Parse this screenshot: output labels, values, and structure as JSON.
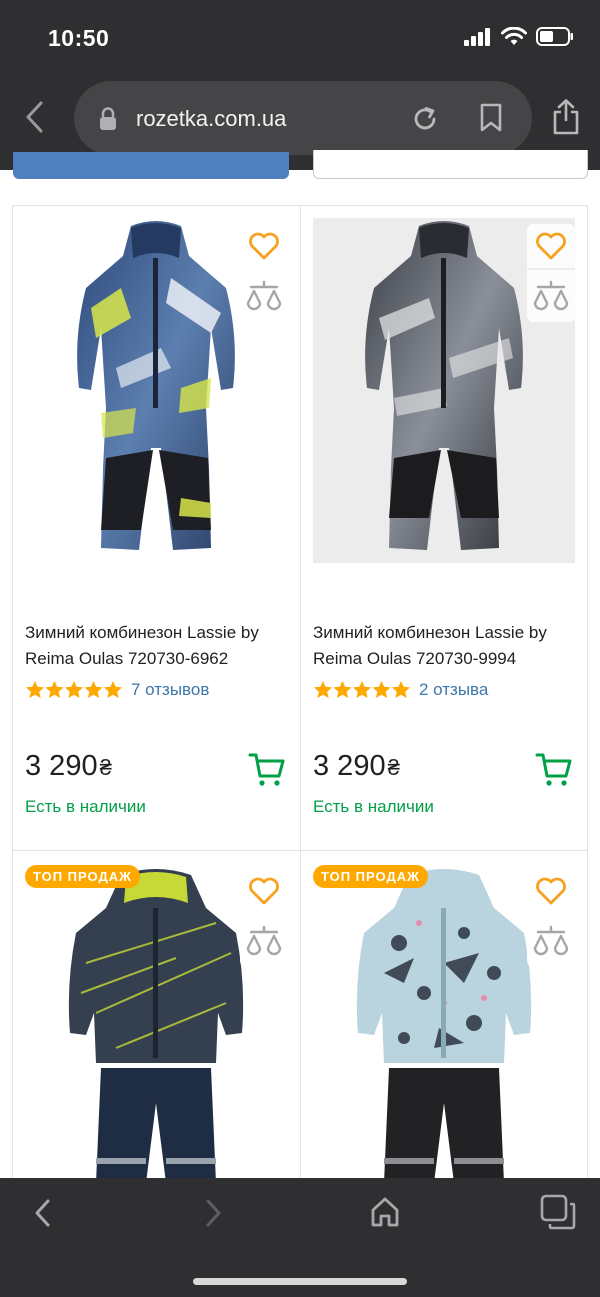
{
  "status_bar": {
    "time": "10:50"
  },
  "browser": {
    "url": "rozetka.com.ua",
    "icons": [
      "back-chevron-icon",
      "lock-icon",
      "reload-icon",
      "bookmark-icon",
      "share-icon"
    ]
  },
  "products": [
    {
      "title": "Зимний комбинезон Lassie by Reima Oulas 720730-6962",
      "stars": 5,
      "reviews": "7 отзывов",
      "price": "3 290",
      "currency": "₴",
      "availability": "Есть в наличии",
      "badge": ""
    },
    {
      "title": "Зимний комбинезон Lassie by Reima Oulas 720730-9994",
      "stars": 5,
      "reviews": "2 отзыва",
      "price": "3 290",
      "currency": "₴",
      "availability": "Есть в наличии",
      "badge": ""
    },
    {
      "badge": "ТОП ПРОДАЖ"
    },
    {
      "badge": "ТОП ПРОДАЖ"
    }
  ],
  "toolbar": {
    "icons": [
      "back-icon",
      "forward-icon",
      "home-icon",
      "tabs-icon"
    ]
  },
  "colors": {
    "chrome_bg": "#2f2f31",
    "favorite_orange": "#f8a11e",
    "price_green": "#00a046",
    "link_blue": "#3e77aa",
    "star_orange": "#ffa900",
    "badge_orange": "#ffa900"
  }
}
